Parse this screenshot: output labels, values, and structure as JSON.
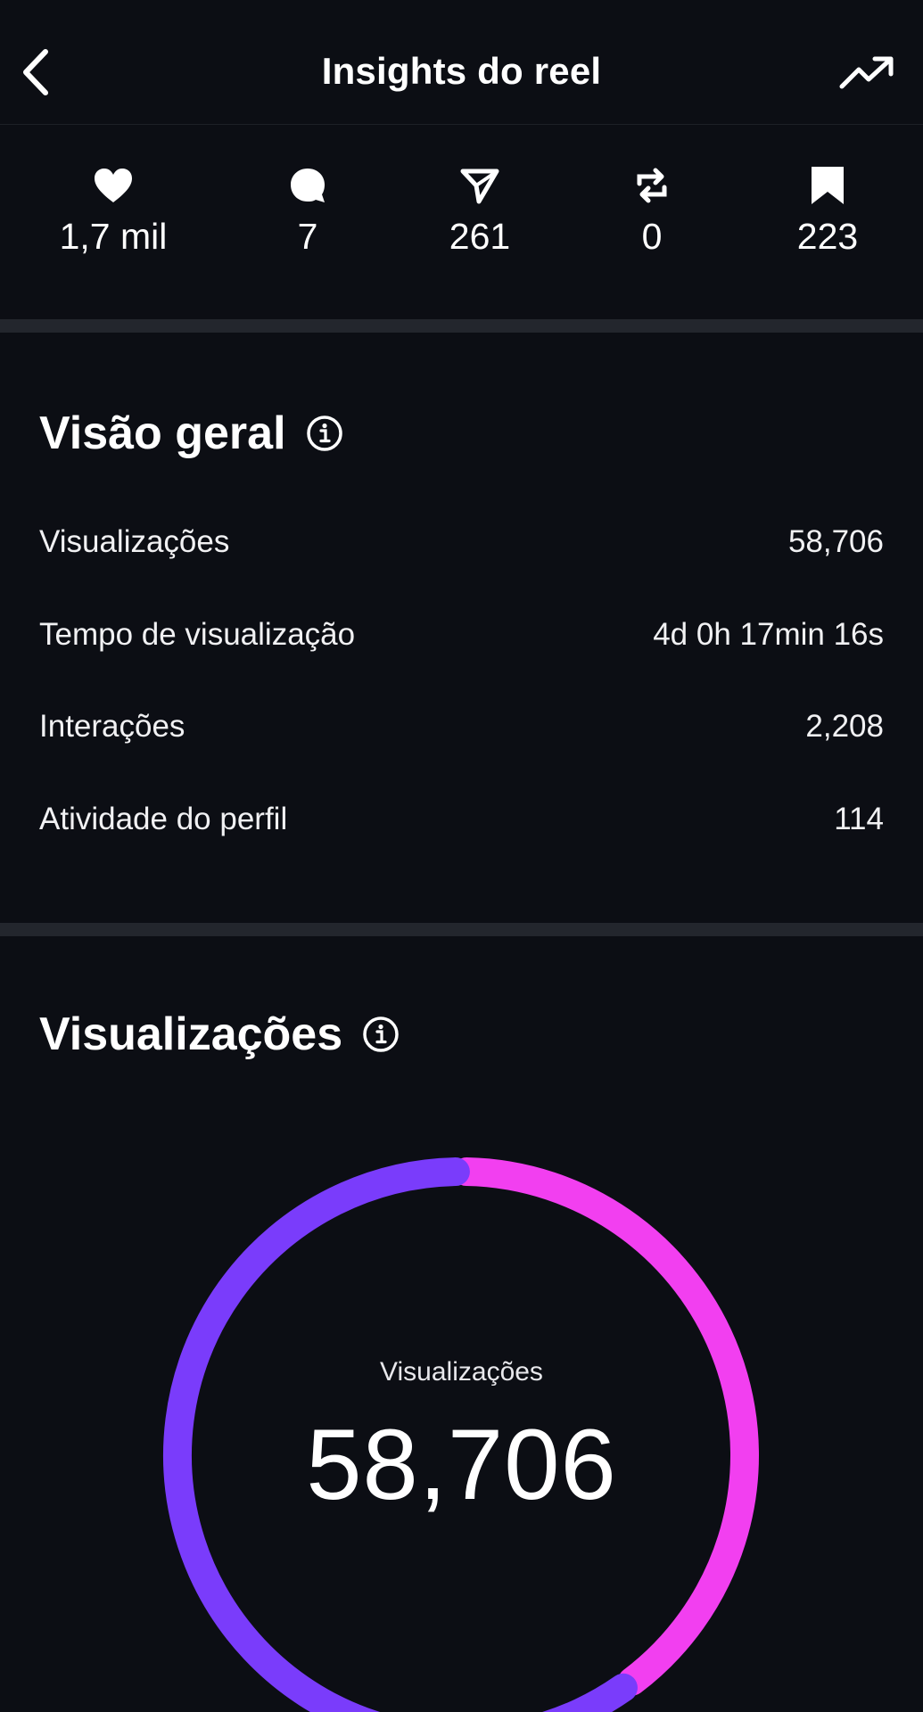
{
  "header": {
    "title": "Insights do reel",
    "back_icon": "chevron-left-icon",
    "trend_icon": "trending-up-icon"
  },
  "metrics": [
    {
      "icon": "heart-icon",
      "value": "1,7 mil"
    },
    {
      "icon": "comment-icon",
      "value": "7"
    },
    {
      "icon": "send-icon",
      "value": "261"
    },
    {
      "icon": "repost-icon",
      "value": "0"
    },
    {
      "icon": "bookmark-icon",
      "value": "223"
    }
  ],
  "overview": {
    "title": "Visão geral",
    "rows": [
      {
        "label": "Visualizações",
        "value": "58,706"
      },
      {
        "label": "Tempo de visualização",
        "value": "4d 0h 17min 16s"
      },
      {
        "label": "Interações",
        "value": "2,208"
      },
      {
        "label": "Atividade do perfil",
        "value": "114"
      }
    ]
  },
  "views": {
    "title": "Visualizações",
    "center_label": "Visualizações",
    "center_value": "58,706",
    "colors": {
      "segment_a": "#7a3cfb",
      "segment_b": "#f23ff0"
    }
  },
  "chart_data": {
    "type": "pie",
    "segments": [
      {
        "color": "#f23ff0",
        "fraction": 0.4
      },
      {
        "color": "#7a3cfb",
        "fraction": 0.6
      }
    ]
  },
  "colors": {
    "background": "#0c0e14",
    "divider": "#23262d",
    "text": "#ffffff"
  }
}
